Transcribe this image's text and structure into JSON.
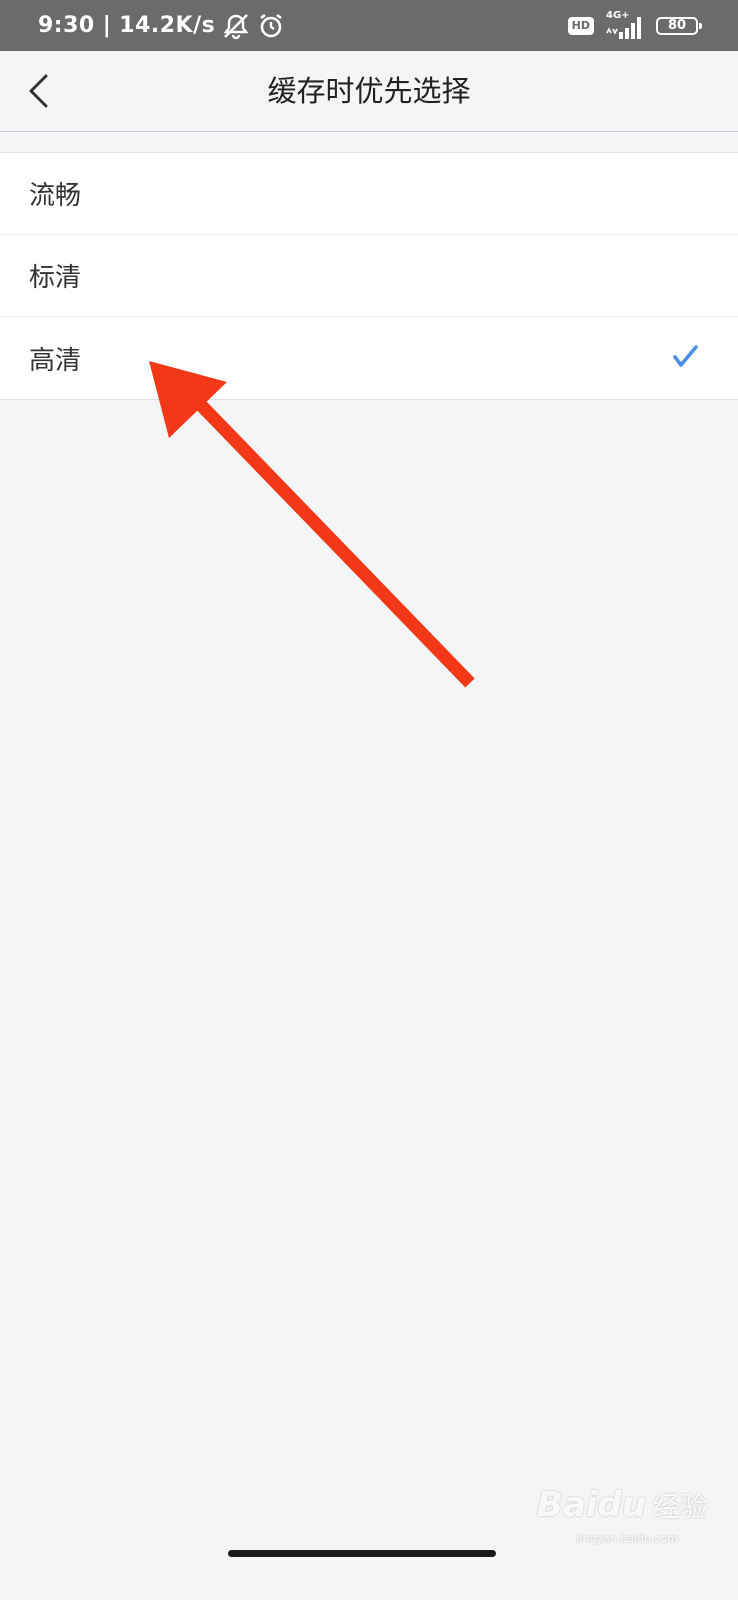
{
  "status_bar": {
    "time": "9:30",
    "separator": "|",
    "network_speed": "14.2K/s",
    "icons": [
      "mute-icon",
      "alarm-icon",
      "hd-badge",
      "signal-icon"
    ],
    "hd_label": "HD",
    "network_type": "4G+",
    "battery_level": "80"
  },
  "nav_bar": {
    "back_icon": "chevron-left-icon",
    "title": "缓存时优先选择"
  },
  "options": [
    {
      "label": "流畅",
      "selected": false
    },
    {
      "label": "标清",
      "selected": false
    },
    {
      "label": "高清",
      "selected": true
    }
  ],
  "colors": {
    "status_bar_bg": "#6b6b6b",
    "page_bg": "#f4f5f7",
    "check_accent": "#4a8fe7",
    "annotation_arrow": "#f33818"
  },
  "annotation": {
    "icon": "arrow-pointer-icon",
    "points_to": "高清"
  },
  "watermark": {
    "brand": "Baidu",
    "sub": "经验",
    "url": "jingyan.baidu.com"
  }
}
